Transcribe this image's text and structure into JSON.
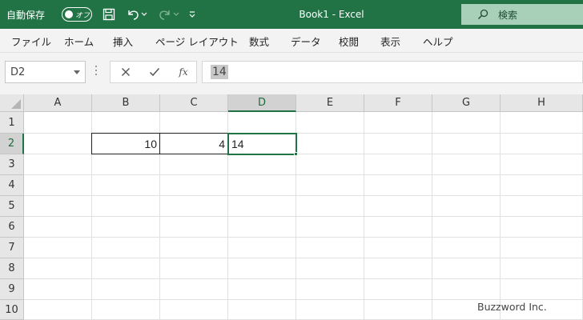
{
  "titlebar": {
    "autosave_label": "自動保存",
    "autosave_state": "オフ",
    "title": "Book1  -  Excel",
    "search_placeholder": "検索"
  },
  "ribbon": {
    "tabs": [
      "ファイル",
      "ホーム",
      "挿入",
      "ページ レイアウト",
      "数式",
      "データ",
      "校閲",
      "表示",
      "ヘルプ"
    ]
  },
  "formula_bar": {
    "name_box": "D2",
    "fx_label": "fx",
    "content": "14"
  },
  "grid": {
    "columns": [
      "A",
      "B",
      "C",
      "D",
      "E",
      "F",
      "G",
      "H"
    ],
    "rows": [
      "1",
      "2",
      "3",
      "4",
      "5",
      "6",
      "7",
      "8",
      "9",
      "10"
    ],
    "active_column": "D",
    "active_row": "2",
    "cells": {
      "B2": "10",
      "C2": "4",
      "D2": "14"
    }
  },
  "watermark": "Buzzword Inc.",
  "colors": {
    "excel_green": "#217346",
    "search_bg": "#a8d0b8"
  }
}
